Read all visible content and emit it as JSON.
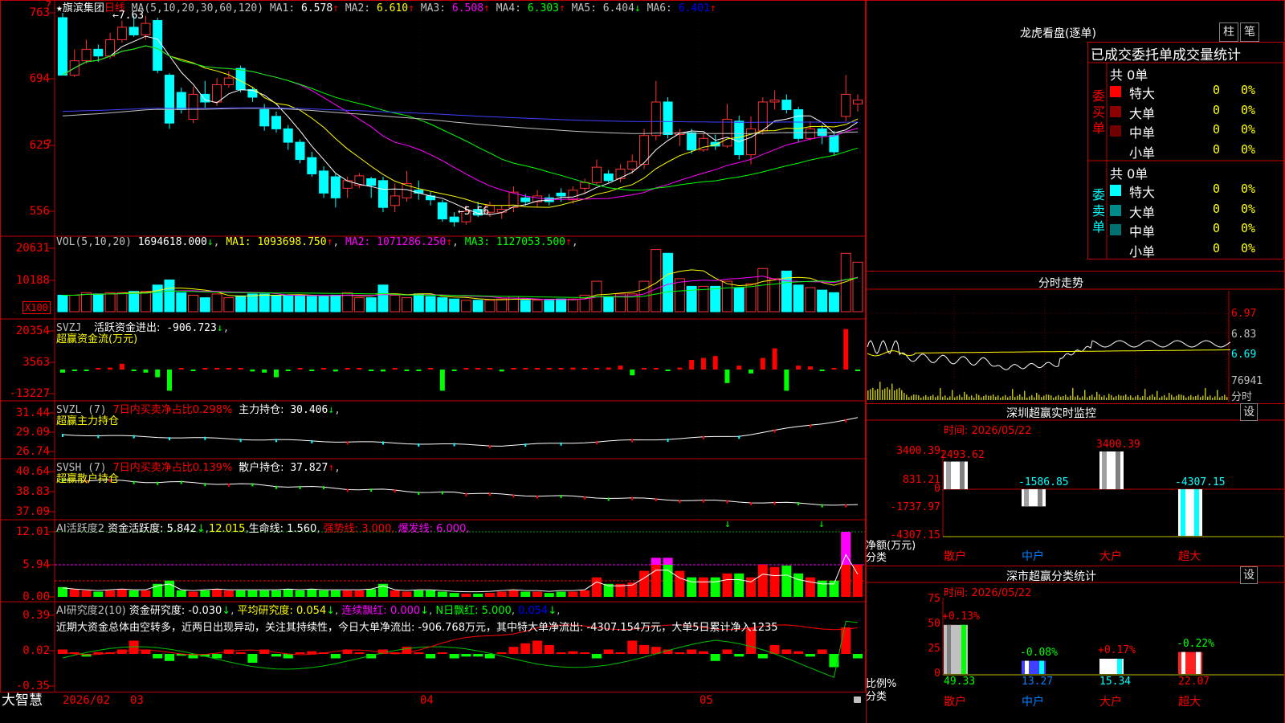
{
  "stock": {
    "star": "★",
    "name": "旗滨集团",
    "period": "日线",
    "ma_params": "MA(5,10,20,30,60,120)"
  },
  "ma_values": [
    {
      "label": "MA1:",
      "value": "6.578",
      "arrow": "↑",
      "color": "#ffffff"
    },
    {
      "label": "MA2:",
      "value": "6.610",
      "arrow": "↑",
      "color": "#ffff00"
    },
    {
      "label": "MA3:",
      "value": "6.508",
      "arrow": "↑",
      "color": "#ff00ff"
    },
    {
      "label": "MA4:",
      "value": "6.303",
      "arrow": "↑",
      "color": "#00ff00"
    },
    {
      "label": "MA5:",
      "value": "6.404",
      "arrow": "↓",
      "color": "#c0c0c0"
    },
    {
      "label": "MA6:",
      "value": "6.401",
      "arrow": "↑",
      "color": "#0000ff"
    }
  ],
  "price_axis": [
    "763",
    "694",
    "625",
    "556"
  ],
  "price_marks": {
    "high": "7.63",
    "low": "5.56",
    "high_prefix": "←",
    "low_prefix": "←"
  },
  "question_marks": [
    "?",
    "?"
  ],
  "vol": {
    "header": "VOL(5,10,20)",
    "value": "1694618.000",
    "arrow": "↓",
    "ma": [
      {
        "label": "MA1:",
        "value": "1093698.750",
        "arrow": "↑",
        "color": "#ffff00"
      },
      {
        "label": "MA2:",
        "value": "1071286.250",
        "arrow": "↑",
        "color": "#ff00ff"
      },
      {
        "label": "MA3:",
        "value": "1127053.500",
        "arrow": "↑",
        "color": "#00ff00"
      }
    ],
    "axis": [
      "20631",
      "10188"
    ],
    "unit": "X100"
  },
  "svzj": {
    "name": "SVZJ",
    "label": "活跃资金进出:",
    "value": "-906.723",
    "arrow": "↓",
    "suffix": ",",
    "sub": "超赢资金流(万元)",
    "axis": [
      "20354",
      "3563",
      "-13227"
    ]
  },
  "svzl": {
    "name": "SVZL",
    "param": "(7)",
    "red_text": "7日内买卖净占比0.298%",
    "label": "主力持仓:",
    "value": "30.406",
    "arrow": "↓",
    "suffix": ",",
    "sub": "超赢主力持仓",
    "axis": [
      "31.44",
      "29.09",
      "26.74"
    ]
  },
  "svsh": {
    "name": "SVSH",
    "param": "(7)",
    "red_text": "7日内买卖净占比0.139%",
    "label": "散户持仓:",
    "value": "37.827",
    "arrow": "↑",
    "suffix": ",",
    "sub": "超赢散户持仓",
    "axis": [
      "40.64",
      "38.83",
      "37.09"
    ]
  },
  "ai1": {
    "name": "AI活跃度2",
    "label1": "资金活跃度:",
    "v1": "5.842",
    "a1": "↓",
    "v2": "12.015",
    "label3": "生命线:",
    "v3": "1.560",
    "red": "强势线: 3.000",
    "mag": "爆发线: 6.000",
    "axis": [
      "12.01",
      "5.94",
      "0.00"
    ]
  },
  "ai2": {
    "name": "AI研究度2(10)",
    "label1": "资金研究度:",
    "v1": "-0.030",
    "a1": "↓",
    "l2": "平均研究度:",
    "v2": "0.054",
    "a2": "↓",
    "l3": "连续飘红:",
    "v3": "0.000",
    "a3": "↓",
    "l4": "N日飘红:",
    "v4": "5.000",
    "l5": "0.054",
    "a5": "↓",
    "comment": "近期大资金总体由空转多，近两日出现异动，关注其持续性，今日大单净流出: -906.768万元，其中特大单净流出: -4307.154万元，大单5日累计净入1235",
    "axis": [
      "0.39",
      "0.02",
      "-0.35"
    ]
  },
  "bottom_bar": {
    "brand": "大智慧",
    "dates": [
      "2026/02",
      "03",
      "04",
      "05"
    ]
  },
  "right": {
    "title": "龙虎看盘(逐单)",
    "btn1": "柱",
    "btn2": "笔",
    "table_title": "已成交委托单成交量统计",
    "buy": {
      "side": [
        "委",
        "买",
        "单"
      ],
      "total": "共 0单",
      "rows": [
        {
          "label": "特大",
          "count": "0",
          "pct": "0%",
          "color": "#ff0000"
        },
        {
          "label": "大单",
          "count": "0",
          "pct": "0%",
          "color": "#8b0000"
        },
        {
          "label": "中单",
          "count": "0",
          "pct": "0%",
          "color": "#700000"
        },
        {
          "label": "小单",
          "count": "0",
          "pct": "0%",
          "color": "#000000"
        }
      ]
    },
    "sell": {
      "side": [
        "委",
        "卖",
        "单"
      ],
      "total": "共 0单",
      "rows": [
        {
          "label": "特大",
          "count": "0",
          "pct": "0%",
          "color": "#00ffff"
        },
        {
          "label": "大单",
          "count": "0",
          "pct": "0%",
          "color": "#008b8b"
        },
        {
          "label": "中单",
          "count": "0",
          "pct": "0%",
          "color": "#007070"
        },
        {
          "label": "小单",
          "count": "0",
          "pct": "0%",
          "color": "#000000"
        }
      ]
    },
    "fenshi": {
      "title": "分时走势",
      "axis": [
        "6.97",
        "6.83",
        "6.69"
      ],
      "vol": "76941",
      "vol_label": "分时"
    },
    "sz_monitor": {
      "title": "深圳超赢实时监控",
      "btn": "设",
      "time": "时间: 2026/05/22",
      "axis": [
        "3400.39",
        "831.21",
        "0",
        "-1737.97",
        "-4307.15"
      ],
      "axis_label": [
        "净额(万元)",
        "分类"
      ],
      "categories": [
        "散户",
        "中户",
        "大户",
        "超大"
      ],
      "values": [
        2493.62,
        -1586.85,
        3400.39,
        -4307.15
      ],
      "value_labels": [
        "2493.62",
        "-1586.85",
        "3400.39",
        "-4307.15"
      ]
    },
    "sz_class": {
      "title": "深市超赢分类统计",
      "btn": "设",
      "time": "时间: 2026/05/22",
      "axis": [
        "75",
        "50",
        "25",
        "0"
      ],
      "axis_label": [
        "比例%",
        "分类"
      ],
      "categories": [
        "散户",
        "中户",
        "大户",
        "超大"
      ],
      "values": [
        49.33,
        13.27,
        15.34,
        22.07
      ],
      "value_labels": [
        "49.33",
        "13.27",
        "15.34",
        "22.07"
      ],
      "changes": [
        "+0.13%",
        "-0.08%",
        "+0.17%",
        "-0.22%"
      ]
    }
  },
  "chart_data": {
    "type": "candlestick",
    "title": "旗滨集团 日线",
    "ylim": [
      5.2,
      7.7
    ],
    "x_ticks": [
      "2026/02",
      "03",
      "04",
      "05"
    ],
    "candles": [
      [
        7.58,
        6.98,
        7.63,
        6.98
      ],
      [
        6.98,
        7.13,
        7.25,
        6.96
      ],
      [
        7.13,
        7.25,
        7.35,
        7.1
      ],
      [
        7.25,
        7.18,
        7.3,
        7.12
      ],
      [
        7.18,
        7.35,
        7.42,
        7.15
      ],
      [
        7.35,
        7.48,
        7.55,
        7.32
      ],
      [
        7.48,
        7.4,
        7.6,
        7.38
      ],
      [
        7.4,
        7.52,
        7.6,
        7.35
      ],
      [
        7.55,
        7.03,
        7.58,
        7.0
      ],
      [
        6.98,
        6.48,
        7.0,
        6.42
      ],
      [
        6.8,
        6.62,
        6.85,
        6.58
      ],
      [
        6.52,
        6.78,
        6.86,
        6.48
      ],
      [
        6.78,
        6.7,
        6.92,
        6.64
      ],
      [
        6.7,
        6.88,
        6.95,
        6.66
      ],
      [
        6.88,
        6.95,
        7.02,
        6.85
      ],
      [
        7.05,
        6.83,
        7.08,
        6.8
      ],
      [
        6.83,
        6.75,
        6.86,
        6.7
      ],
      [
        6.62,
        6.45,
        6.68,
        6.4
      ],
      [
        6.55,
        6.42,
        6.6,
        6.38
      ],
      [
        6.42,
        6.28,
        6.46,
        6.2
      ],
      [
        6.28,
        6.1,
        6.31,
        6.06
      ],
      [
        6.12,
        5.95,
        6.18,
        5.92
      ],
      [
        5.98,
        5.75,
        6.03,
        5.7
      ],
      [
        5.92,
        5.7,
        5.95,
        5.6
      ],
      [
        5.8,
        5.88,
        5.92,
        5.7
      ],
      [
        5.83,
        5.93,
        5.96,
        5.8
      ],
      [
        5.9,
        5.83,
        5.92,
        5.7
      ],
      [
        5.88,
        5.6,
        5.92,
        5.55
      ],
      [
        5.62,
        5.72,
        5.85,
        5.55
      ],
      [
        5.7,
        5.85,
        5.98,
        5.66
      ],
      [
        5.78,
        5.75,
        5.88,
        5.68
      ],
      [
        5.72,
        5.68,
        5.76,
        5.62
      ],
      [
        5.65,
        5.48,
        5.68,
        5.45
      ],
      [
        5.5,
        5.45,
        5.55,
        5.4
      ],
      [
        5.45,
        5.56,
        5.62,
        5.42
      ],
      [
        5.58,
        5.52,
        5.66,
        5.5
      ],
      [
        5.55,
        5.62,
        5.66,
        5.5
      ],
      [
        5.55,
        5.58,
        5.62,
        5.48
      ],
      [
        5.6,
        5.76,
        5.82,
        5.55
      ],
      [
        5.7,
        5.66,
        5.74,
        5.62
      ],
      [
        5.66,
        5.72,
        5.78,
        5.6
      ],
      [
        5.7,
        5.66,
        5.74,
        5.62
      ],
      [
        5.75,
        5.72,
        5.8,
        5.66
      ],
      [
        5.68,
        5.78,
        5.82,
        5.64
      ],
      [
        5.8,
        5.86,
        5.9,
        5.74
      ],
      [
        5.86,
        6.02,
        6.1,
        5.84
      ],
      [
        5.95,
        5.88,
        5.99,
        5.86
      ],
      [
        5.9,
        6.0,
        6.05,
        5.86
      ],
      [
        6.0,
        6.08,
        6.15,
        5.95
      ],
      [
        6.05,
        6.35,
        6.42,
        6.0
      ],
      [
        6.35,
        6.7,
        6.92,
        6.3
      ],
      [
        6.7,
        6.36,
        6.75,
        6.32
      ],
      [
        6.36,
        6.38,
        6.42,
        6.24
      ],
      [
        6.38,
        6.2,
        6.42,
        6.16
      ],
      [
        6.2,
        6.32,
        6.38,
        6.18
      ],
      [
        6.28,
        6.24,
        6.36,
        6.2
      ],
      [
        6.24,
        6.52,
        6.68,
        6.22
      ],
      [
        6.5,
        6.15,
        6.56,
        6.1
      ],
      [
        6.15,
        6.42,
        6.55,
        6.05
      ],
      [
        6.4,
        6.7,
        6.75,
        6.36
      ],
      [
        6.7,
        6.72,
        6.82,
        6.62
      ],
      [
        6.72,
        6.62,
        6.78,
        6.58
      ],
      [
        6.62,
        6.32,
        6.65,
        6.28
      ],
      [
        6.32,
        6.42,
        6.5,
        6.3
      ],
      [
        6.42,
        6.35,
        6.46,
        6.26
      ],
      [
        6.35,
        6.18,
        6.4,
        6.14
      ],
      [
        6.55,
        6.78,
        6.98,
        6.5
      ],
      [
        6.68,
        6.72,
        6.78,
        6.6
      ]
    ]
  }
}
